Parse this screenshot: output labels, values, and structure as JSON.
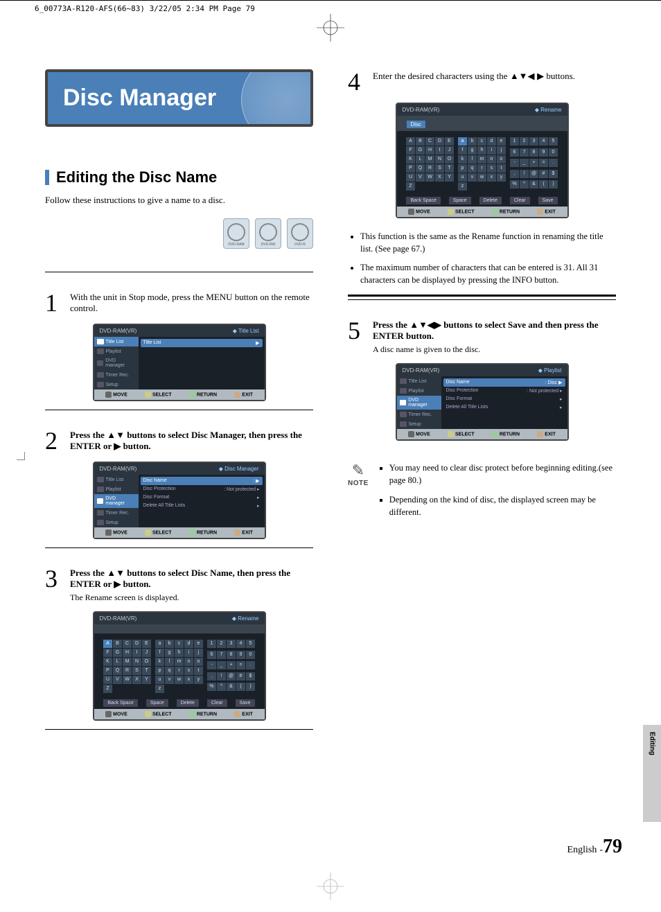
{
  "header_line": "6_00773A-R120-AFS(66~83)  3/22/05  2:34 PM  Page 79",
  "title": "Disc Manager",
  "section_heading": "Editing the Disc Name",
  "intro": "Follow these instructions to give a name to a disc.",
  "media_labels": [
    "DVD-RAM",
    "DVD-RW",
    "DVD-R"
  ],
  "step1": {
    "num": "1",
    "text": "With the unit in Stop mode, press the MENU button on the remote control."
  },
  "step2": {
    "num": "2",
    "text_a": "Press the ",
    "text_b": " buttons to select Disc Manager, then press the ENTER or ",
    "text_c": " button.",
    "arrows_a": "▲▼",
    "arrow_b": "▶"
  },
  "step3": {
    "num": "3",
    "text_a": "Press the ",
    "text_b": " buttons to select Disc Name, then press the ENTER or ",
    "text_c": " button.",
    "arrows_a": "▲▼",
    "arrow_b": "▶",
    "sub": "The Rename screen is displayed."
  },
  "step4": {
    "num": "4",
    "text_a": "Enter the desired characters using the ",
    "text_b": " buttons.",
    "arrows": "▲▼◀ ▶"
  },
  "step5": {
    "num": "5",
    "text_a": "Press the ",
    "text_b": " buttons to select Save and then press the ENTER button.",
    "arrows": "▲▼◀▶",
    "sub": "A disc name is given to the disc."
  },
  "bullets": [
    "This function is the same as the Rename function in renaming the title list. (See page 67.)",
    "The maximum number of characters that can be entered is 31. All 31 characters can be displayed by pressing the INFO button."
  ],
  "note_label": "NOTE",
  "notes": [
    "You may need to clear disc protect before beginning editing.(see page 80.)",
    "Depending on the kind of disc, the displayed screen may be different."
  ],
  "side_tab": "Editing",
  "footer": {
    "lang": "English",
    "dash": "-",
    "page": "79"
  },
  "screenshots": {
    "common": {
      "device": "DVD-RAM(VR)",
      "move": "MOVE",
      "select": "SELECT",
      "return": "RETURN",
      "exit": "EXIT"
    },
    "sidebar_items": [
      "Title List",
      "Playlist",
      "DVD manager",
      "Timer Rec.",
      "Setup"
    ],
    "ss1": {
      "right_label": "Title List",
      "main_row": "Title List"
    },
    "ss2": {
      "right_label": "Disc Manager",
      "rows": [
        {
          "l": "Disc Name",
          "r": ":"
        },
        {
          "l": "Disc Protection",
          "r": ": Not protected"
        },
        {
          "l": "Disc Format",
          "r": ""
        },
        {
          "l": "Delete All Title Lists",
          "r": ""
        }
      ]
    },
    "ss3": {
      "right_label": "Rename",
      "disc_label_blank": "",
      "upper": [
        "A",
        "B",
        "C",
        "D",
        "E",
        "F",
        "G",
        "H",
        "I",
        "J",
        "K",
        "L",
        "M",
        "N",
        "O",
        "P",
        "Q",
        "R",
        "S",
        "T",
        "U",
        "V",
        "W",
        "X",
        "Y",
        "Z"
      ],
      "lower": [
        "a",
        "b",
        "c",
        "d",
        "e",
        "f",
        "g",
        "h",
        "i",
        "j",
        "k",
        "l",
        "m",
        "n",
        "o",
        "p",
        "q",
        "r",
        "s",
        "t",
        "u",
        "v",
        "w",
        "x",
        "y",
        "z"
      ],
      "nums": [
        "1",
        "2",
        "3",
        "4",
        "5",
        "6",
        "7",
        "8",
        "9",
        "0",
        "-",
        "_",
        "+",
        "=",
        ".",
        ",",
        "!",
        "@",
        "#",
        "$",
        "%",
        "^",
        "&",
        "(",
        ")"
      ],
      "actions": [
        "Back Space",
        "Space",
        "Delete",
        "Clear",
        "Save"
      ]
    },
    "ss4": {
      "right_label": "Rename",
      "disc_label": "Disc",
      "hl_lower": "a"
    },
    "ss5": {
      "right_label": "Playlist",
      "rows": [
        {
          "l": "Disc Name",
          "r": ": Disc"
        },
        {
          "l": "Disc Protection",
          "r": ": Not protected"
        },
        {
          "l": "Disc Format",
          "r": ""
        },
        {
          "l": "Delete All Title Lists",
          "r": ""
        }
      ]
    }
  }
}
